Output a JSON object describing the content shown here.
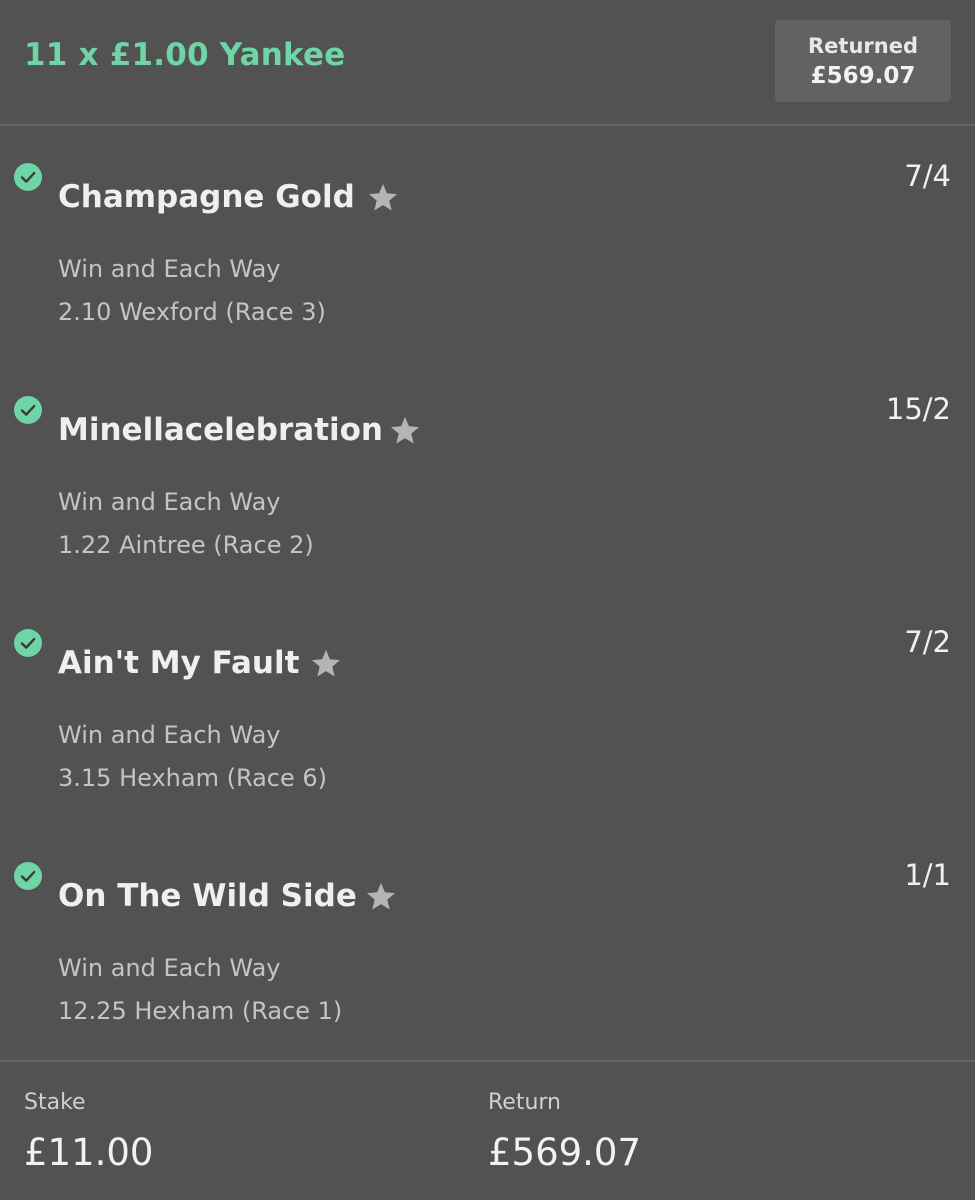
{
  "header": {
    "bet_title": "11 x £1.00 Yankee",
    "returned_label": "Returned",
    "returned_value": "£569.07"
  },
  "selections": [
    {
      "name": "Champagne Gold",
      "odds": "7/4",
      "market": "Win and Each Way",
      "race": "2.10 Wexford (Race 3)",
      "status_icon": "check-circle-icon",
      "favourite_icon": "star-icon"
    },
    {
      "name": "Minellacelebration",
      "odds": "15/2",
      "market": "Win and Each Way",
      "race": "1.22 Aintree (Race 2)",
      "status_icon": "check-circle-icon",
      "favourite_icon": "star-icon"
    },
    {
      "name": "Ain't My Fault",
      "odds": "7/2",
      "market": "Win and Each Way",
      "race": "3.15 Hexham (Race 6)",
      "status_icon": "check-circle-icon",
      "favourite_icon": "star-icon"
    },
    {
      "name": "On The Wild Side",
      "odds": "1/1",
      "market": "Win and Each Way",
      "race": "12.25 Hexham (Race 1)",
      "status_icon": "check-circle-icon",
      "favourite_icon": "star-icon"
    }
  ],
  "footer": {
    "stake_label": "Stake",
    "stake_value": "£11.00",
    "return_label": "Return",
    "return_value": "£569.07"
  },
  "colors": {
    "background": "#525252",
    "accent_green": "#6fd4a6",
    "returned_box": "#626262",
    "star": "#b5b5b5"
  }
}
